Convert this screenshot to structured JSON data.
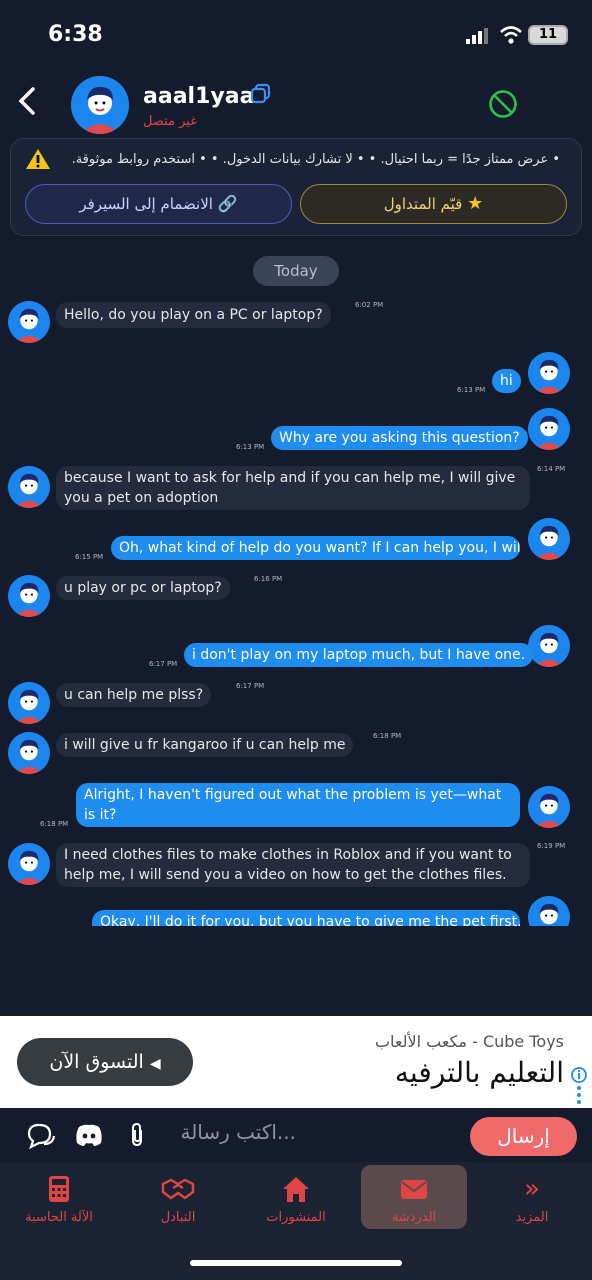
{
  "status": {
    "time": "6:38",
    "battery": "11"
  },
  "header": {
    "username": "aaal1yaa",
    "status_text": "غير متصل"
  },
  "warning": {
    "text": "• عرض ممتاز جدًا = ربما احتيال. • • لا تشارك بيانات الدخول. • • استخدم روابط موثوقة.",
    "trade_button": "قيّم المتداول",
    "join_button": "الانضمام إلى السيرفر"
  },
  "chat": {
    "date_label": "Today",
    "messages": [
      {
        "dir": "in",
        "text": "Hello, do you play on a PC or laptop?",
        "time": "6:02 PM"
      },
      {
        "dir": "out",
        "text": "hi",
        "time": "6:13 PM"
      },
      {
        "dir": "out",
        "text": "Why are you asking this question?",
        "time": "6:13 PM"
      },
      {
        "dir": "in",
        "text": "because I want to ask for help and if you can help me, I will give you a pet on adoption",
        "time": "6:14 PM"
      },
      {
        "dir": "out",
        "text": "Oh, what kind of help do you want? If I can help you, I will",
        "time": "6:15 PM"
      },
      {
        "dir": "in",
        "text": "u play or pc or laptop?",
        "time": "6:16 PM"
      },
      {
        "dir": "out",
        "text": "i don't play on my laptop much, but I have one.",
        "time": "6:17 PM"
      },
      {
        "dir": "in",
        "text": "u can help me plss?",
        "time": "6:17 PM"
      },
      {
        "dir": "in",
        "text": "i will give u fr kangaroo if u can help me",
        "time": "6:18 PM"
      },
      {
        "dir": "out",
        "text": "Alright, I haven't figured out what the problem is yet—what is it?",
        "time": "6:18 PM"
      },
      {
        "dir": "in",
        "text": "I need clothes files to make clothes in Roblox and if you want to help me, I will send you a video on how to get the clothes files.",
        "time": "6:19 PM"
      },
      {
        "dir": "out",
        "text": "Okay, I'll do it for you, but you have to give me the pet first.",
        "time": ""
      }
    ]
  },
  "ad": {
    "title": "مكعب الألعاب - Cube Toys",
    "text": "التعليم بالترفيه",
    "button": "التسوق الآن"
  },
  "input": {
    "placeholder": "اكتب رسالة...",
    "send": "إرسال"
  },
  "nav": {
    "items": [
      {
        "label": "المزيد",
        "icon": "double-chevron-icon"
      },
      {
        "label": "الدردشة",
        "icon": "envelope-icon"
      },
      {
        "label": "المنشورات",
        "icon": "home-icon"
      },
      {
        "label": "التبادل",
        "icon": "handshake-icon"
      },
      {
        "label": "الآلة الحاسبة",
        "icon": "calculator-icon"
      }
    ]
  },
  "colors": {
    "accent": "#1f8cf0",
    "danger": "#e04545",
    "background": "#141b2d"
  }
}
